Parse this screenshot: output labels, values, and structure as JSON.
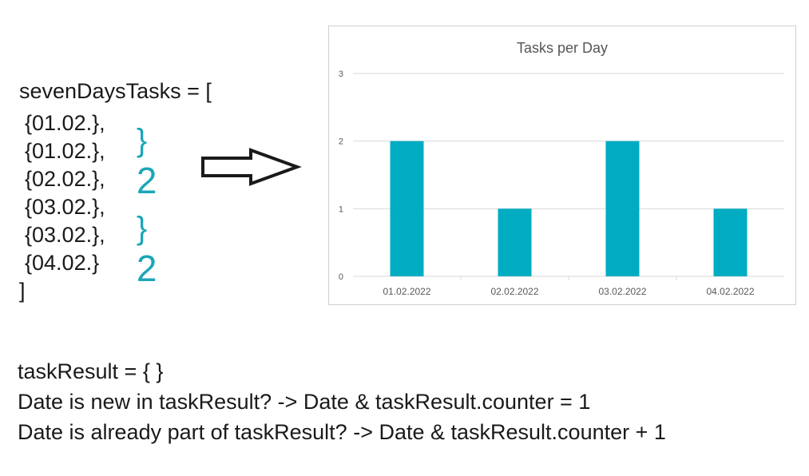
{
  "code": {
    "header": "sevenDaysTasks = [",
    "items": [
      "{01.02.},",
      "{01.02.},",
      "{02.02.},",
      "{03.02.},",
      "{03.02.},",
      "{04.02.}"
    ],
    "closing": "]"
  },
  "annotations": [
    {
      "brace": "}",
      "count": "2"
    },
    {
      "brace": "}",
      "count": "2"
    }
  ],
  "accent_color": "#1ba6b8",
  "chart_data": {
    "type": "bar",
    "title": "Tasks per Day",
    "categories": [
      "01.02.2022",
      "02.02.2022",
      "03.02.2022",
      "04.02.2022"
    ],
    "values": [
      2,
      1,
      2,
      1
    ],
    "ylim": [
      0,
      3
    ],
    "yticks": [
      "0",
      "1",
      "2",
      "3"
    ],
    "xlabel": "",
    "ylabel": "",
    "grid": true,
    "bar_color": "#00acc1"
  },
  "notes": {
    "line1": "taskResult = { }",
    "line2": "Date is new in taskResult? -> Date & taskResult.counter = 1",
    "line3": "Date is already part of taskResult? -> Date & taskResult.counter + 1"
  }
}
